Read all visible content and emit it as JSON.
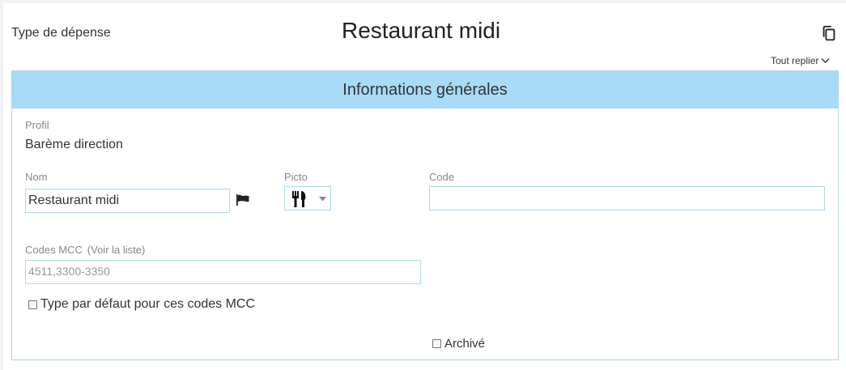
{
  "header": {
    "type_label": "Type de dépense",
    "title": "Restaurant midi",
    "collapse_all": "Tout replier"
  },
  "section": {
    "title": "Informations générales",
    "profil_label": "Profil",
    "profil_value": "Barème direction",
    "nom_label": "Nom",
    "nom_value": "Restaurant midi",
    "picto_label": "Picto",
    "picto_icon": "fork-knife-icon",
    "code_label": "Code",
    "code_value": "",
    "mcc_label": "Codes MCC",
    "mcc_link": "(Voir la liste)",
    "mcc_placeholder": "4511,3300-3350",
    "mcc_value": "",
    "default_type_label": "Type par défaut pour ces codes MCC",
    "default_type_checked": false,
    "archived_label": "Archivé",
    "archived_checked": false
  },
  "colors": {
    "section_header_bg": "#a7dbf7",
    "border": "#a9d8ef"
  }
}
